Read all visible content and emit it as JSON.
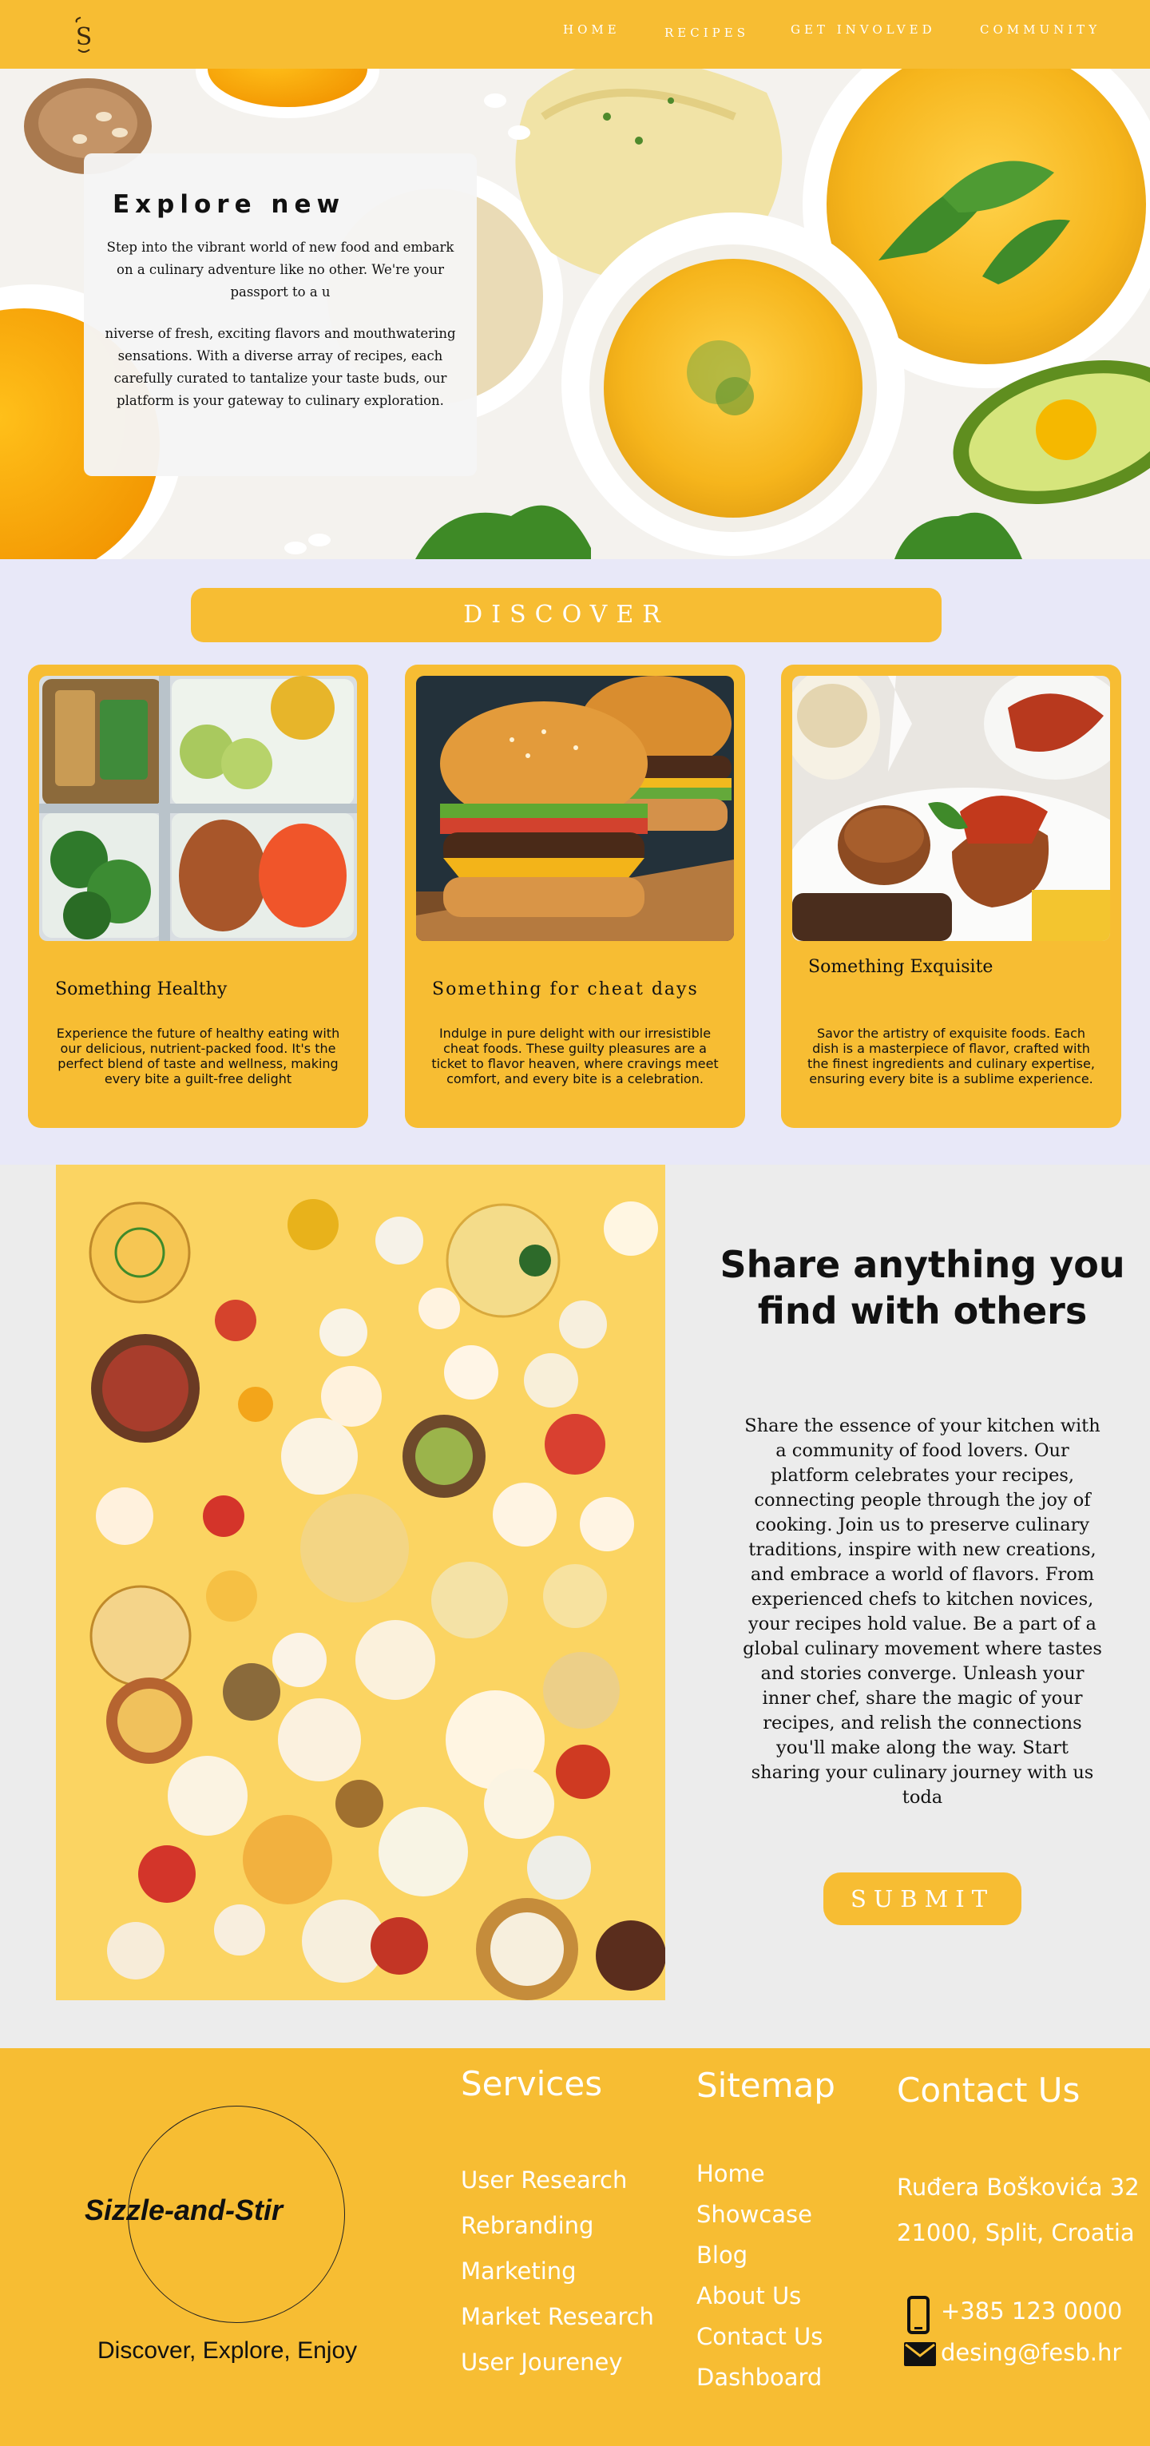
{
  "nav": {
    "logo": "S",
    "links": [
      "HOME",
      "RECIPES",
      "GET INVOLVED",
      "COMMUNITY"
    ]
  },
  "hero": {
    "title": "Explore new",
    "paragraph1": "Step into the vibrant world of new food and embark on a culinary adventure like no other. We're your passport to a u",
    "paragraph2": "niverse of fresh, exciting flavors and mouthwatering sensations. With a diverse array of recipes, each carefully curated to tantalize your taste buds, our platform is your gateway to culinary exploration."
  },
  "discover": {
    "button_label": "DISCOVER",
    "cards": [
      {
        "title": "Something Healthy",
        "text": "Experience the future of healthy eating with our delicious, nutrient-packed food. It's the perfect blend of taste and wellness, making every bite a guilt-free delight",
        "image": "meal-prep-containers"
      },
      {
        "title": "Something for cheat days",
        "text": "Indulge in pure delight with our irresistible cheat foods. These guilty pleasures are a ticket to flavor heaven, where cravings meet comfort, and every bite is a celebration.",
        "image": "cheeseburgers"
      },
      {
        "title": "Something Exquisite",
        "text": "Savor the artistry of exquisite foods. Each dish is a masterpiece of flavor, crafted with the finest ingredients and culinary expertise, ensuring every bite is a sublime experience.",
        "image": "plated-fine-dining"
      }
    ]
  },
  "share": {
    "title": "Share anything you find with others",
    "text": "Share the essence of your kitchen with a community of food lovers. Our platform celebrates your recipes, connecting people through the joy of cooking. Join us to preserve culinary traditions, inspire with new creations, and embrace a world of flavors. From experienced chefs to kitchen novices, your recipes hold value. Be a part of a global culinary movement where tastes and stories converge. Unleash your inner chef, share the magic of your recipes, and relish the connections you'll make along the way. Start sharing your culinary journey with us toda",
    "button_label": "SUBMIT"
  },
  "footer": {
    "brand": "Sizzle-and-Stir",
    "tagline": "Discover, Explore, Enjoy",
    "services_heading": "Services",
    "services": [
      "User Research",
      "Rebranding",
      "Marketing",
      "Market Research",
      "User Joureney"
    ],
    "sitemap_heading": "Sitemap",
    "sitemap": [
      "Home",
      "Showcase",
      "Blog",
      "About Us",
      "Contact Us",
      "Dashboard"
    ],
    "contact_heading": "Contact Us",
    "address_line1": "Ruđera Boškovića 32",
    "address_line2": "21000, Split, Croatia",
    "phone": "+385 123 0000",
    "email": "desing@fesb.hr",
    "icons": [
      "phone-icon",
      "mail-icon"
    ]
  },
  "colors": {
    "accent": "#f7bd33",
    "discover_bg": "#e8e8f8",
    "page_bg": "#ececec"
  }
}
